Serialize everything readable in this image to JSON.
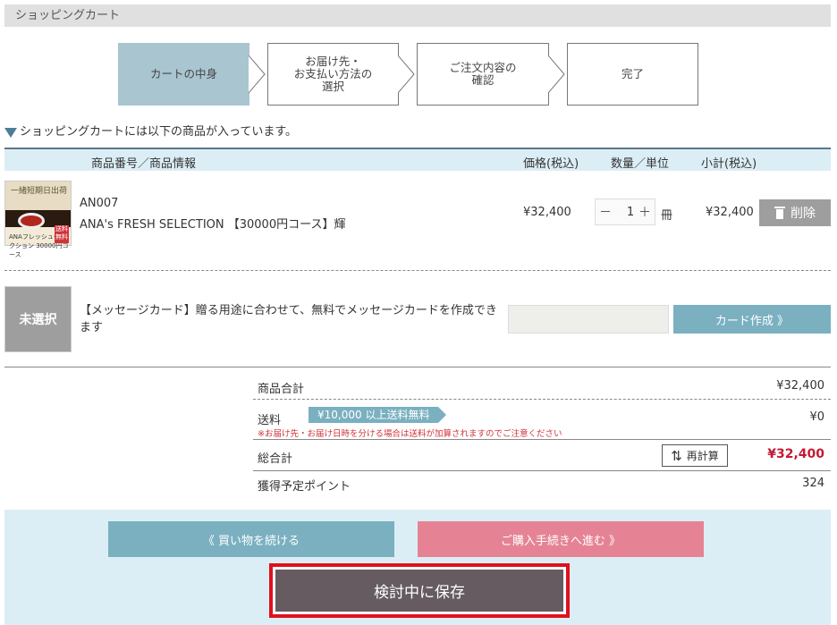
{
  "page_title": "ショッピングカート",
  "steps": [
    {
      "label": "カートの中身"
    },
    {
      "label": "お届け先・\nお支払い方法の\n選択"
    },
    {
      "label": "ご注文内容の\n確認"
    },
    {
      "label": "完了"
    }
  ],
  "cart_note": "ショッピングカートには以下の商品が入っています。",
  "table_headers": {
    "product": "商品番号／商品情報",
    "price": "価格(税込)",
    "qty": "数量／単位",
    "subtotal": "小計(税込)"
  },
  "item": {
    "image_title": "一緒短期日出荷",
    "image_caption": "ANAフレッシュセレクション 30000円コース",
    "image_badge": "送料無料",
    "code": "AN007",
    "name": "ANA's FRESH SELECTION 【30000円コース】輝",
    "price": "¥32,400",
    "qty": "1",
    "unit": "冊",
    "subtotal": "¥32,400",
    "delete_label": "削除"
  },
  "message_card": {
    "image_label": "未選択",
    "description": "【メッセージカード】贈る用途に合わせて、無料でメッセージカードを作成できます",
    "input_value": "",
    "button_label": "カード作成 》"
  },
  "summary": {
    "goods_total_label": "商品合計",
    "goods_total_value": "¥32,400",
    "shipping_label": "送料",
    "shipping_badge": "¥10,000 以上送料無料",
    "shipping_value": "¥0",
    "shipping_note": "※お届け先・お届け日時を分ける場合は送料が加算されますのでご注意ください",
    "grand_total_label": "総合計",
    "recalc_label": "再計算",
    "grand_total_value": "¥32,400",
    "points_label": "獲得予定ポイント",
    "points_value": "324"
  },
  "actions": {
    "continue_label": "《 買い物を続ける",
    "proceed_label": "ご購入手続きへ進む 》",
    "save_label": "検討中に保存"
  },
  "colors": {
    "accent_blue": "#7ab0c0",
    "accent_pink": "#e58395",
    "total_red": "#c21b35",
    "highlight_red": "#e0101e",
    "save_dark": "#655b60"
  }
}
